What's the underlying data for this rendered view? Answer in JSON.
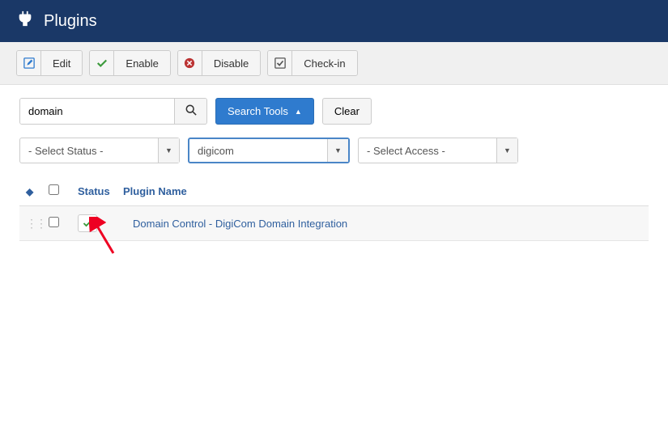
{
  "header": {
    "title": "Plugins"
  },
  "toolbar": {
    "edit": "Edit",
    "enable": "Enable",
    "disable": "Disable",
    "checkin": "Check-in"
  },
  "search": {
    "value": "domain",
    "search_tools": "Search Tools",
    "clear": "Clear"
  },
  "filters": {
    "status_placeholder": "- Select Status -",
    "folder_value": "digicom",
    "access_placeholder": "- Select Access -"
  },
  "columns": {
    "status": "Status",
    "plugin_name": "Plugin Name"
  },
  "rows": [
    {
      "name": "Domain Control - DigiCom Domain Integration",
      "enabled": true
    }
  ]
}
